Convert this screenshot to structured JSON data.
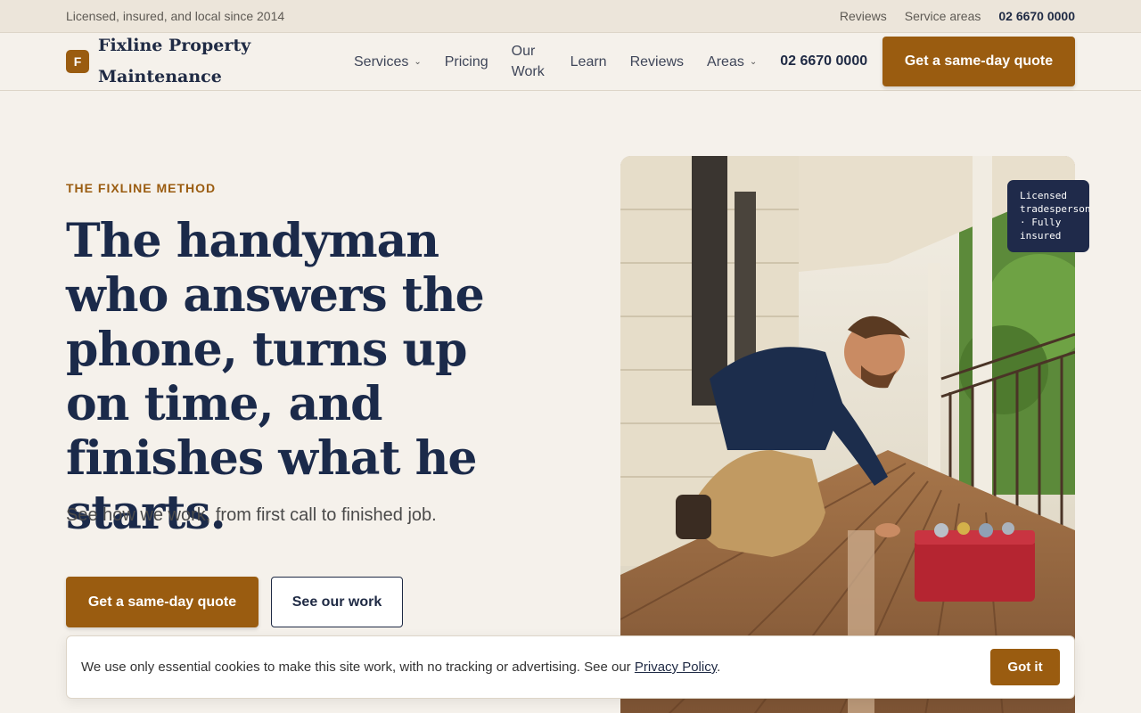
{
  "topbar": {
    "tagline": "Licensed, insured, and local since 2014",
    "links": [
      "Reviews",
      "Service areas"
    ],
    "phone": "02 6670 0000"
  },
  "nav": {
    "brand_initial": "F",
    "brand_name": "Fixline Property Maintenance",
    "items": [
      "Services",
      "Pricing",
      "Our Work",
      "Learn",
      "Reviews",
      "Areas"
    ],
    "phone": "02 6670 0000",
    "cta": "Get a same-day quote"
  },
  "hero": {
    "eyebrow": "THE FIXLINE METHOD",
    "headline": "The handyman who answers the phone, turns up on time, and finishes what he starts.",
    "sub": "See how we work, from first call to finished job.",
    "cta_primary": "Get a same-day quote",
    "cta_secondary": "See our work",
    "badge": "Licensed tradesperson · Fully insured"
  },
  "cookie": {
    "text": "We use only essential cookies to make this site work, with no tracking or advertising. See our ",
    "link": "Privacy Policy",
    "end": ".",
    "button": "Got it"
  },
  "colors": {
    "accent": "#9a5c10",
    "navy": "#1f2a44",
    "background": "#f5f1eb"
  }
}
